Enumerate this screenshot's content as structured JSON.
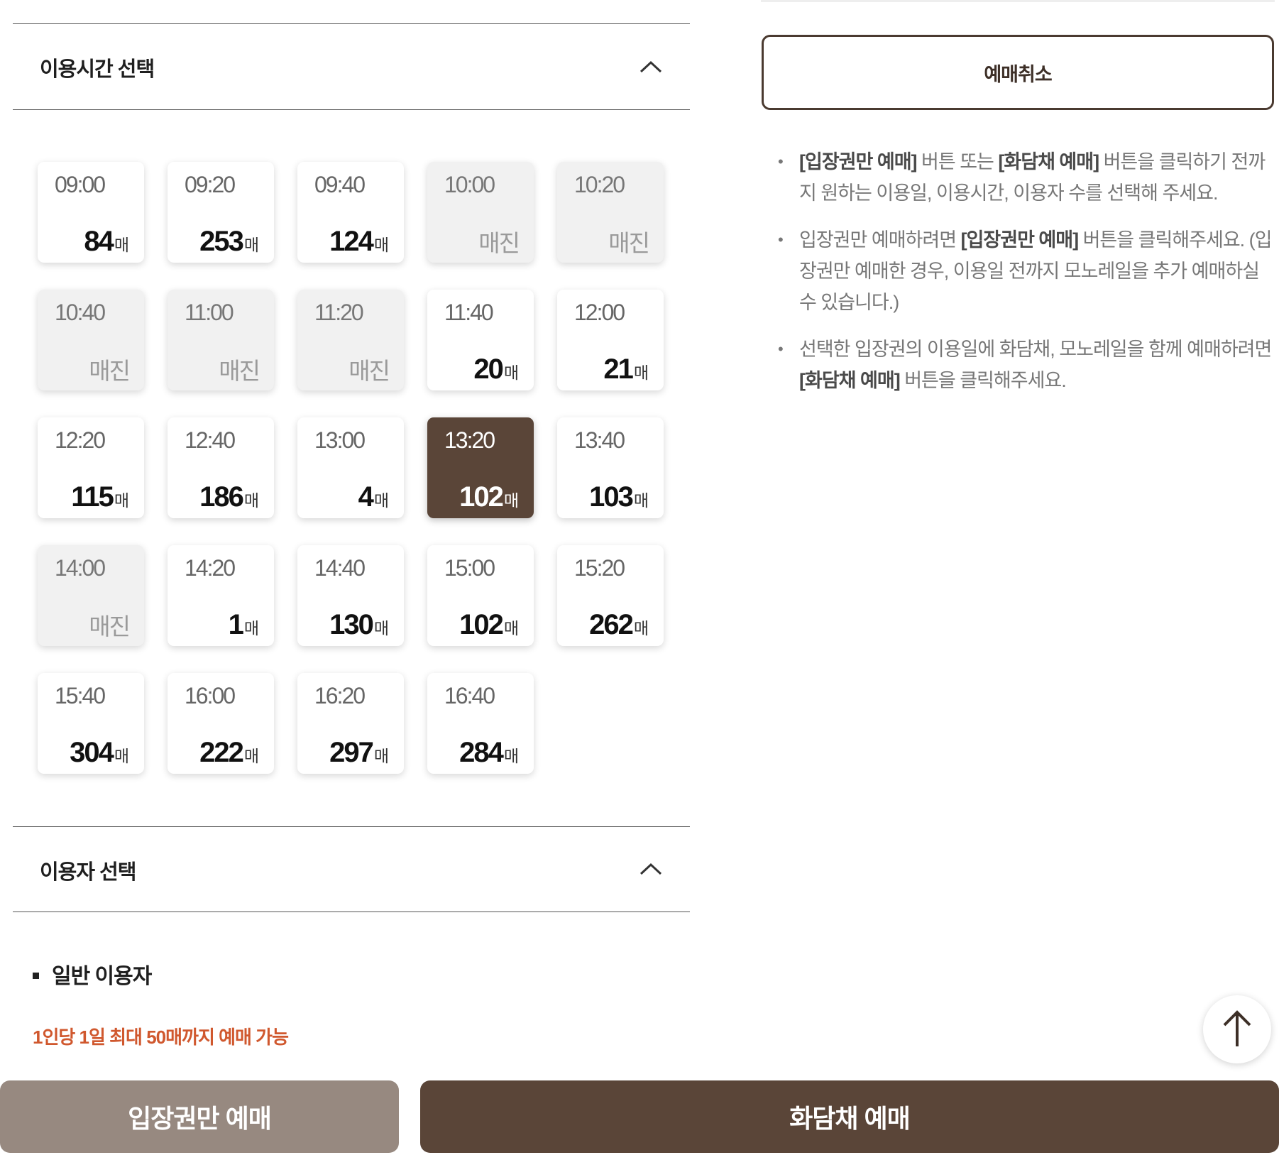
{
  "time_section": {
    "title": "이용시간 선택",
    "slots": [
      {
        "time": "09:00",
        "count": "84",
        "unit": "매",
        "status": "available"
      },
      {
        "time": "09:20",
        "count": "253",
        "unit": "매",
        "status": "available"
      },
      {
        "time": "09:40",
        "count": "124",
        "unit": "매",
        "status": "available"
      },
      {
        "time": "10:00",
        "count": "매진",
        "unit": "",
        "status": "soldout"
      },
      {
        "time": "10:20",
        "count": "매진",
        "unit": "",
        "status": "soldout"
      },
      {
        "time": "10:40",
        "count": "매진",
        "unit": "",
        "status": "soldout"
      },
      {
        "time": "11:00",
        "count": "매진",
        "unit": "",
        "status": "soldout"
      },
      {
        "time": "11:20",
        "count": "매진",
        "unit": "",
        "status": "soldout"
      },
      {
        "time": "11:40",
        "count": "20",
        "unit": "매",
        "status": "available"
      },
      {
        "time": "12:00",
        "count": "21",
        "unit": "매",
        "status": "available"
      },
      {
        "time": "12:20",
        "count": "115",
        "unit": "매",
        "status": "available"
      },
      {
        "time": "12:40",
        "count": "186",
        "unit": "매",
        "status": "available"
      },
      {
        "time": "13:00",
        "count": "4",
        "unit": "매",
        "status": "available"
      },
      {
        "time": "13:20",
        "count": "102",
        "unit": "매",
        "status": "selected"
      },
      {
        "time": "13:40",
        "count": "103",
        "unit": "매",
        "status": "available"
      },
      {
        "time": "14:00",
        "count": "매진",
        "unit": "",
        "status": "soldout"
      },
      {
        "time": "14:20",
        "count": "1",
        "unit": "매",
        "status": "available"
      },
      {
        "time": "14:40",
        "count": "130",
        "unit": "매",
        "status": "available"
      },
      {
        "time": "15:00",
        "count": "102",
        "unit": "매",
        "status": "available"
      },
      {
        "time": "15:20",
        "count": "262",
        "unit": "매",
        "status": "available"
      },
      {
        "time": "15:40",
        "count": "304",
        "unit": "매",
        "status": "available"
      },
      {
        "time": "16:00",
        "count": "222",
        "unit": "매",
        "status": "available"
      },
      {
        "time": "16:20",
        "count": "297",
        "unit": "매",
        "status": "available"
      },
      {
        "time": "16:40",
        "count": "284",
        "unit": "매",
        "status": "available"
      }
    ]
  },
  "user_section": {
    "title": "이용자 선택",
    "subsection": "일반 이용자",
    "limit_text": "1인당 1일 최대 50매까지 예매 가능"
  },
  "side": {
    "cancel_label": "예매취소",
    "notes": {
      "n1_b1": "[입장권만 예매]",
      "n1_t1": " 버튼 또는 ",
      "n1_b2": "[화담채 예매]",
      "n1_t2": " 버튼을 클릭하기 전까지 원하는 이용일, 이용시간, 이용자 수를 선택해 주세요.",
      "n2_t1": "입장권만 예매하려면 ",
      "n2_b1": "[입장권만 예매]",
      "n2_t2": " 버튼을 클릭해주세요. (입장권만 예매한 경우, 이용일 전까지 모노레일을 추가 예매하실 수 있습니다.)",
      "n3_t1": "선택한 입장권의 이용일에 화담채, 모노레일을 함께 예매하려면 ",
      "n3_b1": "[화담채 예매]",
      "n3_t2": " 버튼을 클릭해주세요."
    }
  },
  "buttons": {
    "entry_only": "입장권만 예매",
    "combo": "화담채 예매"
  },
  "icons": {
    "collapse": "chevron-up-icon",
    "scroll_top": "arrow-up-icon"
  },
  "colors": {
    "brand_brown": "#5a4538",
    "muted_brown": "#978980",
    "accent_orange": "#d0582e",
    "soldout_bg": "#f1f1f1"
  }
}
